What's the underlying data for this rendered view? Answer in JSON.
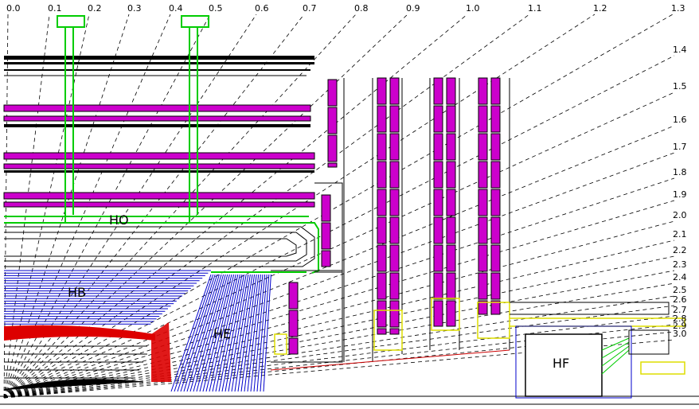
{
  "eta_labels": [
    "0.0",
    "0.1",
    "0.2",
    "0.3",
    "0.4",
    "0.5",
    "0.6",
    "0.7",
    "0.8",
    "0.9",
    "1.0",
    "1.1",
    "1.2",
    "1.3",
    "1.4",
    "1.5",
    "1.6",
    "1.7",
    "1.8",
    "1.9",
    "2.0",
    "2.1",
    "2.2",
    "2.3",
    "2.4",
    "2.5",
    "2.6",
    "2.7",
    "2.8",
    "2.9",
    "3.0"
  ],
  "regions": {
    "ho": "HO",
    "hb": "HB",
    "he": "HE",
    "hf": "HF"
  },
  "colors": {
    "muon": "#cc00cc",
    "hcal_barrel": "#0000cc",
    "hcal_outer": "#00cc00",
    "ecal": "#dd0000",
    "forward": "#dddd00",
    "steel": "#000000",
    "beam": "#cc0000"
  }
}
